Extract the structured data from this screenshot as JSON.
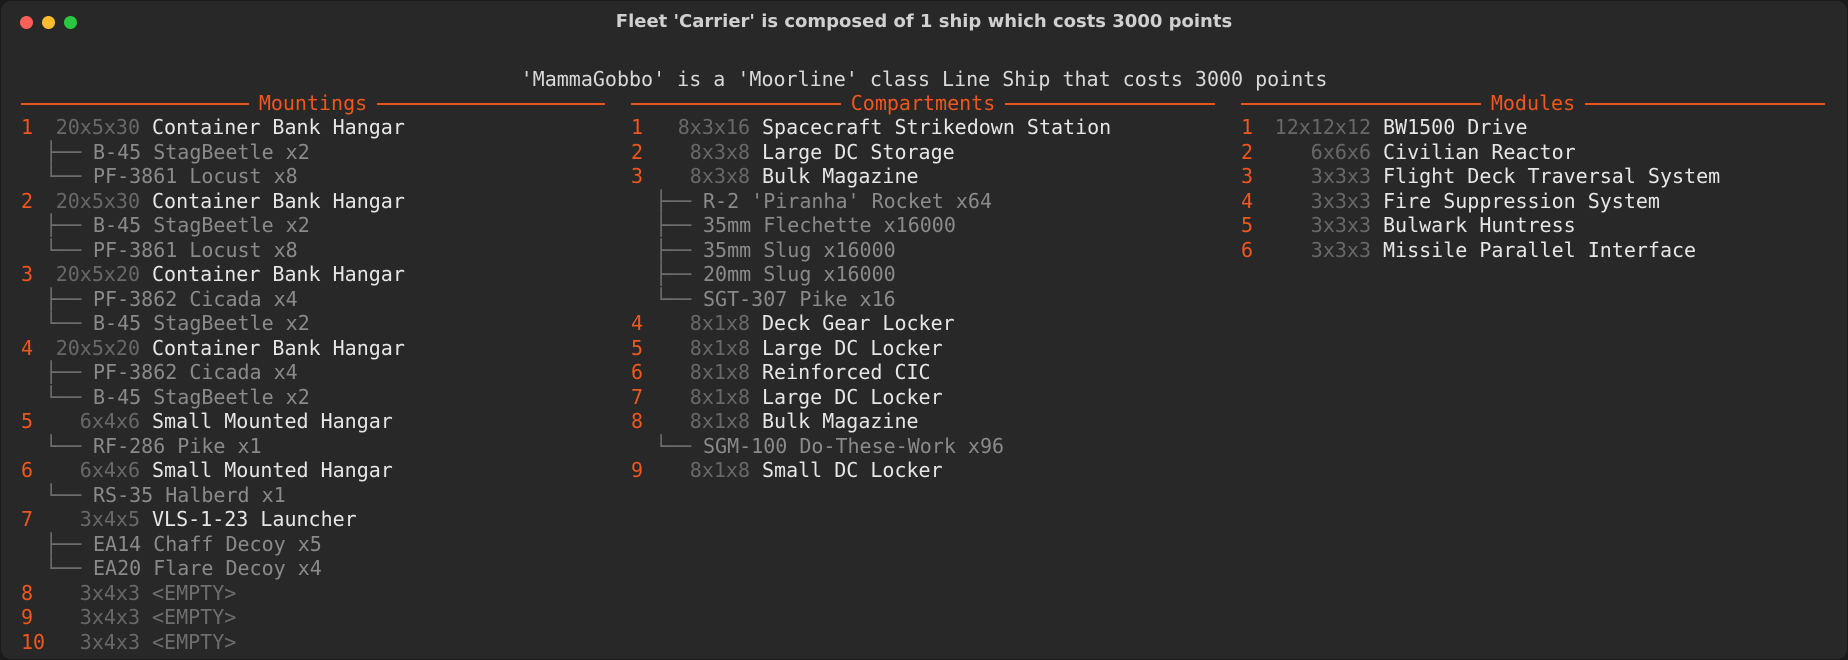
{
  "window": {
    "title": "Fleet 'Carrier' is composed of 1 ship which costs 3000 points"
  },
  "ship_line": "'MammaGobbo' is a 'Moorline' class Line Ship that costs 3000 points",
  "columns": {
    "mountings": {
      "header": "Mountings",
      "rows": [
        {
          "type": "item",
          "index": "1",
          "size": "20x5x30",
          "name": "Container Bank Hangar"
        },
        {
          "type": "sub",
          "branch": "├──",
          "text": "B-45 StagBeetle x2"
        },
        {
          "type": "sub",
          "branch": "└──",
          "text": "PF-3861 Locust x8"
        },
        {
          "type": "item",
          "index": "2",
          "size": "20x5x30",
          "name": "Container Bank Hangar"
        },
        {
          "type": "sub",
          "branch": "├──",
          "text": "B-45 StagBeetle x2"
        },
        {
          "type": "sub",
          "branch": "└──",
          "text": "PF-3861 Locust x8"
        },
        {
          "type": "item",
          "index": "3",
          "size": "20x5x20",
          "name": "Container Bank Hangar"
        },
        {
          "type": "sub",
          "branch": "├──",
          "text": "PF-3862 Cicada x4"
        },
        {
          "type": "sub",
          "branch": "└──",
          "text": "B-45 StagBeetle x2"
        },
        {
          "type": "item",
          "index": "4",
          "size": "20x5x20",
          "name": "Container Bank Hangar"
        },
        {
          "type": "sub",
          "branch": "├──",
          "text": "PF-3862 Cicada x4"
        },
        {
          "type": "sub",
          "branch": "└──",
          "text": "B-45 StagBeetle x2"
        },
        {
          "type": "item",
          "index": "5",
          "size": "6x4x6",
          "name": "Small Mounted Hangar"
        },
        {
          "type": "sub",
          "branch": "└──",
          "text": "RF-286 Pike x1"
        },
        {
          "type": "item",
          "index": "6",
          "size": "6x4x6",
          "name": "Small Mounted Hangar"
        },
        {
          "type": "sub",
          "branch": "└──",
          "text": "RS-35 Halberd x1"
        },
        {
          "type": "item",
          "index": "7",
          "size": "3x4x5",
          "name": "VLS-1-23 Launcher"
        },
        {
          "type": "sub",
          "branch": "├──",
          "text": "EA14 Chaff Decoy x5"
        },
        {
          "type": "sub",
          "branch": "└──",
          "text": "EA20 Flare Decoy x4"
        },
        {
          "type": "empty",
          "index": "8",
          "size": "3x4x3",
          "name": "<EMPTY>"
        },
        {
          "type": "empty",
          "index": "9",
          "size": "3x4x3",
          "name": "<EMPTY>"
        },
        {
          "type": "empty",
          "index": "10",
          "size": "3x4x3",
          "name": "<EMPTY>"
        }
      ]
    },
    "compartments": {
      "header": "Compartments",
      "rows": [
        {
          "type": "item",
          "index": "1",
          "size": "8x3x16",
          "name": "Spacecraft Strikedown Station"
        },
        {
          "type": "item",
          "index": "2",
          "size": "8x3x8",
          "name": "Large DC Storage"
        },
        {
          "type": "item",
          "index": "3",
          "size": "8x3x8",
          "name": "Bulk Magazine"
        },
        {
          "type": "sub",
          "branch": "├──",
          "text": "R-2 'Piranha' Rocket x64"
        },
        {
          "type": "sub",
          "branch": "├──",
          "text": "35mm Flechette x16000"
        },
        {
          "type": "sub",
          "branch": "├──",
          "text": "35mm Slug x16000"
        },
        {
          "type": "sub",
          "branch": "├──",
          "text": "20mm Slug x16000"
        },
        {
          "type": "sub",
          "branch": "└──",
          "text": "SGT-307 Pike x16"
        },
        {
          "type": "item",
          "index": "4",
          "size": "8x1x8",
          "name": "Deck Gear Locker"
        },
        {
          "type": "item",
          "index": "5",
          "size": "8x1x8",
          "name": "Large DC Locker"
        },
        {
          "type": "item",
          "index": "6",
          "size": "8x1x8",
          "name": "Reinforced CIC"
        },
        {
          "type": "item",
          "index": "7",
          "size": "8x1x8",
          "name": "Large DC Locker"
        },
        {
          "type": "item",
          "index": "8",
          "size": "8x1x8",
          "name": "Bulk Magazine"
        },
        {
          "type": "sub",
          "branch": "└──",
          "text": "SGM-100 Do-These-Work x96"
        },
        {
          "type": "item",
          "index": "9",
          "size": "8x1x8",
          "name": "Small DC Locker"
        }
      ]
    },
    "modules": {
      "header": "Modules",
      "rows": [
        {
          "type": "item",
          "index": "1",
          "size": "12x12x12",
          "name": "BW1500 Drive"
        },
        {
          "type": "item",
          "index": "2",
          "size": "6x6x6",
          "name": "Civilian Reactor"
        },
        {
          "type": "item",
          "index": "3",
          "size": "3x3x3",
          "name": "Flight Deck Traversal System"
        },
        {
          "type": "item",
          "index": "4",
          "size": "3x3x3",
          "name": "Fire Suppression System"
        },
        {
          "type": "item",
          "index": "5",
          "size": "3x3x3",
          "name": "Bulwark Huntress"
        },
        {
          "type": "item",
          "index": "6",
          "size": "3x3x3",
          "name": "Missile Parallel Interface"
        }
      ]
    }
  }
}
